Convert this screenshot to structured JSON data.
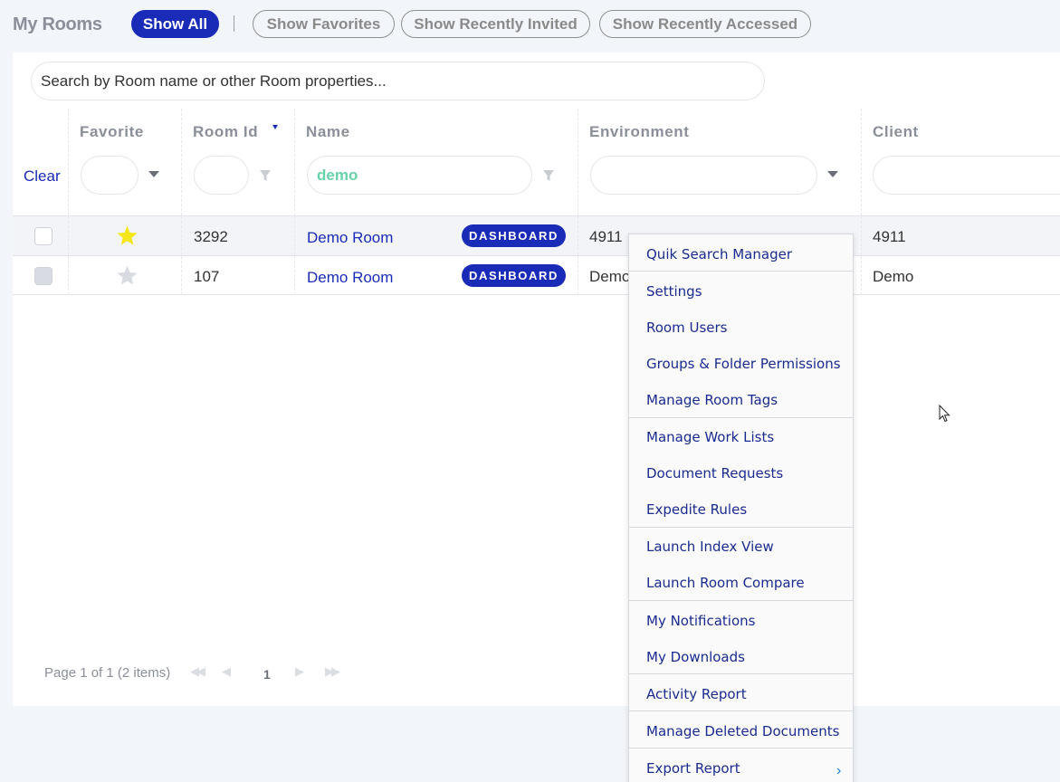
{
  "header": {
    "title": "My Rooms",
    "filters": [
      {
        "label": "Show All",
        "active": true
      },
      {
        "label": "Show Favorites",
        "active": false
      },
      {
        "label": "Show Recently Invited",
        "active": false
      },
      {
        "label": "Show Recently Accessed",
        "active": false
      }
    ]
  },
  "search": {
    "placeholder": "Search by Room name or other Room properties..."
  },
  "grid": {
    "clear_label": "Clear",
    "columns": {
      "favorite": "Favorite",
      "room_id": "Room Id",
      "name": "Name",
      "environment": "Environment",
      "client": "Client"
    },
    "filters": {
      "name_value": "demo"
    },
    "rows": [
      {
        "favorite": true,
        "room_id": "3292",
        "name": "Demo Room",
        "badge": "DASHBOARD",
        "environment": "4911",
        "client": "4911"
      },
      {
        "favorite": false,
        "room_id": "107",
        "name": "Demo Room",
        "badge": "DASHBOARD",
        "environment": "Demo",
        "client": "Demo"
      }
    ],
    "pager": {
      "info": "Page 1 of 1 (2 items)",
      "page": "1"
    }
  },
  "context_menu": {
    "items": [
      "Quik Search Manager",
      "Settings",
      "Room Users",
      "Groups & Folder Permissions",
      "Manage Room Tags",
      "Manage Work Lists",
      "Document Requests",
      "Expedite Rules",
      "Launch Index View",
      "Launch Room Compare",
      "My Notifications",
      "My Downloads",
      "Activity Report",
      "Manage Deleted Documents",
      "Export Report"
    ]
  },
  "colors": {
    "accent": "#1a2bb8",
    "filter_text": "#66d3a8",
    "star_on": "#f5e61a",
    "star_off": "#d8dbe1"
  },
  "icons": [
    "star-icon",
    "funnel-icon",
    "chevron-down-icon",
    "chevron-right-icon",
    "first-page-icon",
    "prev-page-icon",
    "next-page-icon",
    "last-page-icon",
    "mouse-cursor-icon"
  ]
}
